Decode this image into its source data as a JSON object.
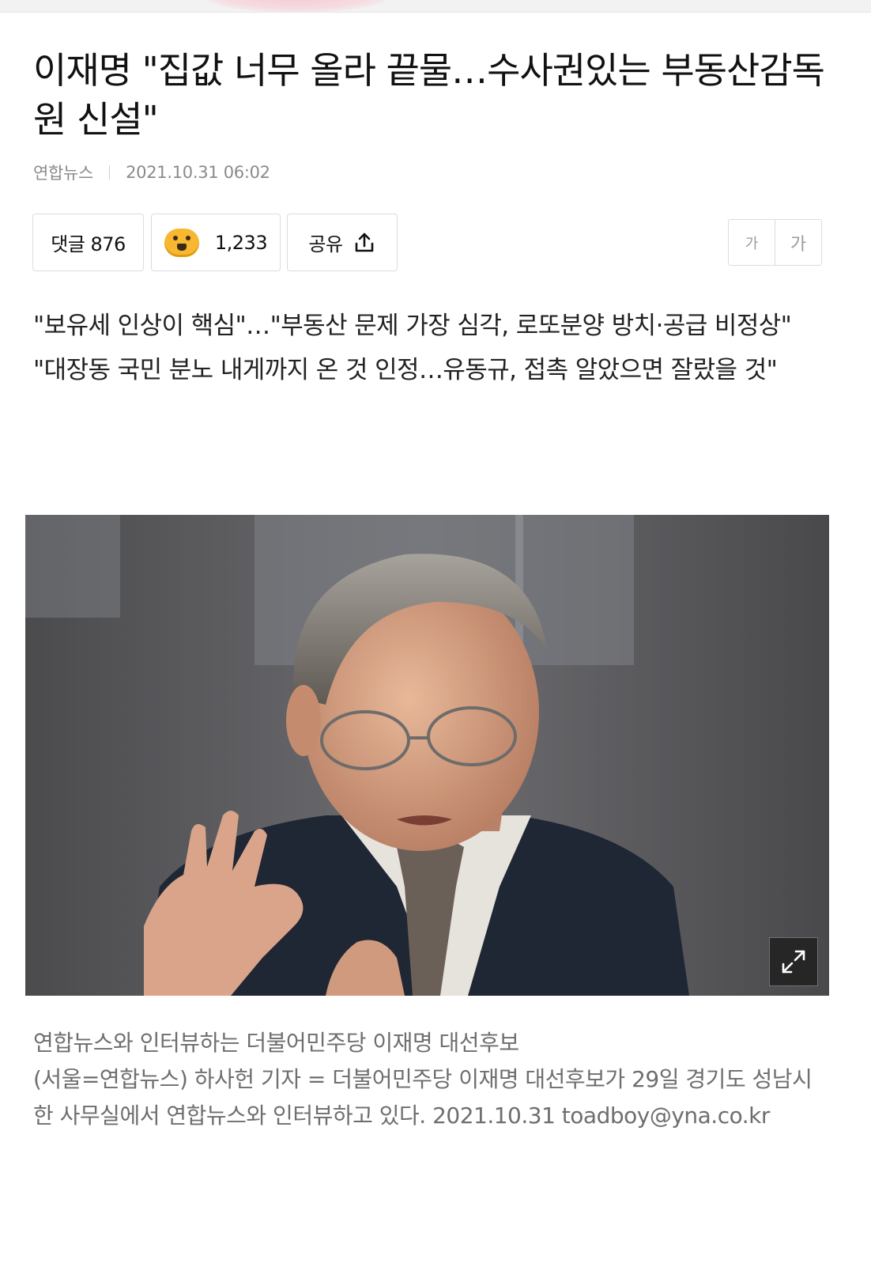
{
  "article": {
    "headline": "이재명 \"집값 너무 올라 끝물…수사권있는 부동산감독원 신설\"",
    "source": "연합뉴스",
    "datetime": "2021.10.31 06:02"
  },
  "actions": {
    "comment_label": "댓글 876",
    "reaction_count": "1,233",
    "share_label": "공유",
    "font_small_label": "가",
    "font_large_label": "가"
  },
  "subheadings": [
    "\"보유세 인상이 핵심\"…\"부동산 문제 가장 심각, 로또분양 방치·공급 비정상\"",
    "\"대장동 국민 분노 내게까지 온 것 인정…유동규, 접촉 알았으면 잘랐을 것\""
  ],
  "photo": {
    "caption_title": "연합뉴스와 인터뷰하는 더불어민주당 이재명 대선후보",
    "caption_body": "(서울=연합뉴스) 하사헌 기자 = 더불어민주당 이재명 대선후보가 29일 경기도 성남시 한 사무실에서 연합뉴스와 인터뷰하고 있다. 2021.10.31 toadboy@yna.co.kr"
  },
  "icons": {
    "reaction": "reaction-face-icon",
    "share": "share-upload-icon",
    "expand": "expand-arrows-icon"
  },
  "colors": {
    "text_primary": "#111111",
    "text_meta": "#8a8a8a",
    "caption": "#6e6e6e",
    "border": "#dcdcdc",
    "reaction_yellow": "#f7b731"
  }
}
